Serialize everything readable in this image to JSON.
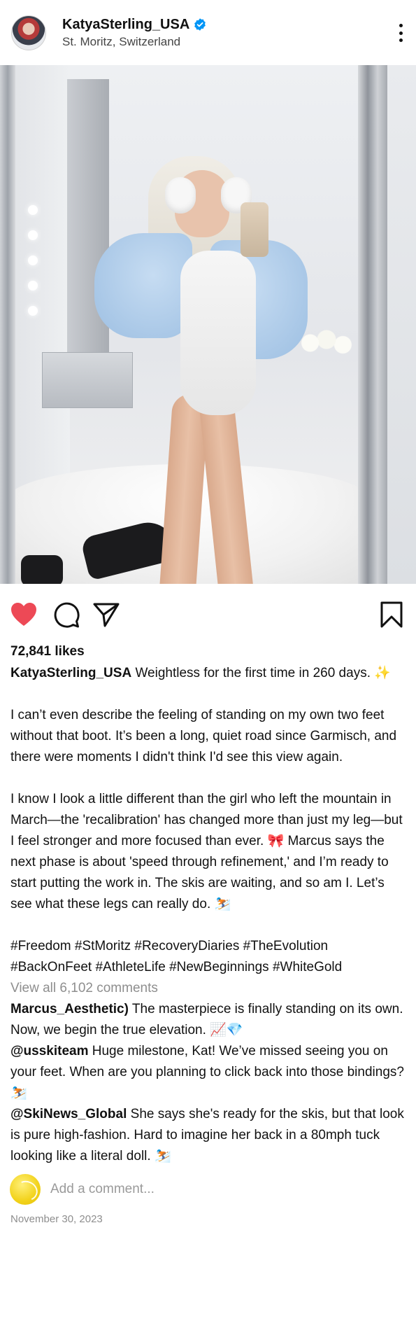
{
  "header": {
    "username": "KatyaSterling_USA",
    "location": "St. Moritz, Switzerland",
    "verified_icon": "verified-badge-icon",
    "menu_icon": "more-options-icon"
  },
  "photo": {
    "alt_subject": "mirror-selfie"
  },
  "actions": {
    "like_icon": "heart-icon",
    "like_color": "#ed4956",
    "comment_icon": "speech-bubble-icon",
    "share_icon": "paper-plane-icon",
    "save_icon": "bookmark-icon"
  },
  "likes": "72,841 likes",
  "caption": {
    "username": "KatyaSterling_USA",
    "line1": "Weightless for the first time in 260 days. ✨",
    "para1": "I can’t even describe the feeling of standing on my own two feet without that boot. It’s been a long, quiet road since Garmisch, and there were moments I didn't think I'd see this view again.",
    "para2": "I know I look a little different than the girl who left the mountain in March—the 'recalibration' has changed more than just my leg—but I feel stronger and more focused than ever. 🎀 Marcus says the next phase is about 'speed through refinement,' and I’m ready to start putting the work in. The skis are waiting, and so am I. Let’s see what these legs can really do. ⛷️",
    "hashtags": "#Freedom #StMoritz #RecoveryDiaries #TheEvolution #BackOnFeet #AthleteLife #NewBeginnings #WhiteGold"
  },
  "view_all_comments": "View all 6,102 comments",
  "comments": [
    {
      "username": "Marcus_Aesthetic)",
      "text": "The masterpiece is finally standing on its own. Now, we begin the true elevation. 📈💎"
    },
    {
      "username": "@usskiteam",
      "text": "Huge milestone, Kat! We’ve missed seeing you on your feet. When are you planning to click back into those bindings? ⛷️"
    },
    {
      "username": "@SkiNews_Global",
      "text": "She says she's ready for the skis, but that look is pure high-fashion. Hard to imagine her back in a 80mph tuck looking like a literal doll. ⛷️"
    }
  ],
  "add_comment": {
    "placeholder": "Add a comment..."
  },
  "date": "November 30, 2023"
}
